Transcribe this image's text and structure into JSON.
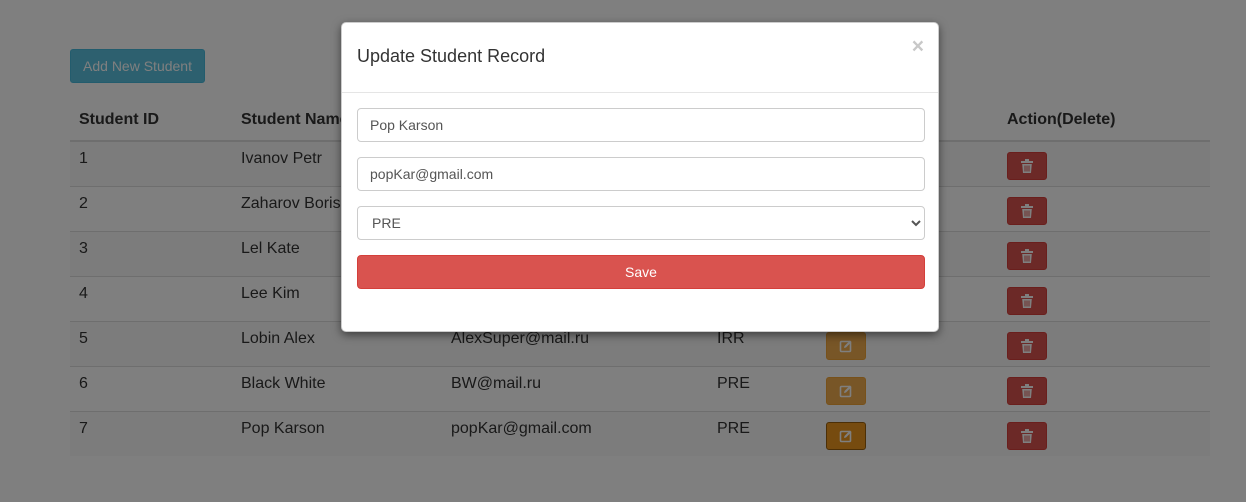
{
  "toolbar": {
    "add_label": "Add New Student"
  },
  "table": {
    "headers": [
      "Student ID",
      "Student Name",
      "",
      "",
      "",
      "Action(Delete)"
    ],
    "rows": [
      {
        "id": "1",
        "name": "Ivanov Petr",
        "email": "",
        "group": ""
      },
      {
        "id": "2",
        "name": "Zaharov Boris",
        "email": "",
        "group": ""
      },
      {
        "id": "3",
        "name": "Lel Kate",
        "email": "",
        "group": ""
      },
      {
        "id": "4",
        "name": "Lee Kim",
        "email": "",
        "group": ""
      },
      {
        "id": "5",
        "name": "Lobin Alex",
        "email": "AlexSuper@mail.ru",
        "group": "IRR"
      },
      {
        "id": "6",
        "name": "Black White",
        "email": "BW@mail.ru",
        "group": "PRE"
      },
      {
        "id": "7",
        "name": "Pop Karson",
        "email": "popKar@gmail.com",
        "group": "PRE"
      }
    ]
  },
  "modal": {
    "title": "Update Student Record",
    "close_label": "×",
    "name_value": "Pop Karson",
    "email_value": "popKar@gmail.com",
    "group_options": [
      "PRE"
    ],
    "save_label": "Save"
  },
  "icons": {
    "edit": "edit-icon",
    "delete": "trash-icon"
  },
  "colors": {
    "info": "#5bc0de",
    "warning": "#f0ad4e",
    "danger": "#d9534f",
    "overlay": "rgba(0,0,0,0.5)"
  }
}
